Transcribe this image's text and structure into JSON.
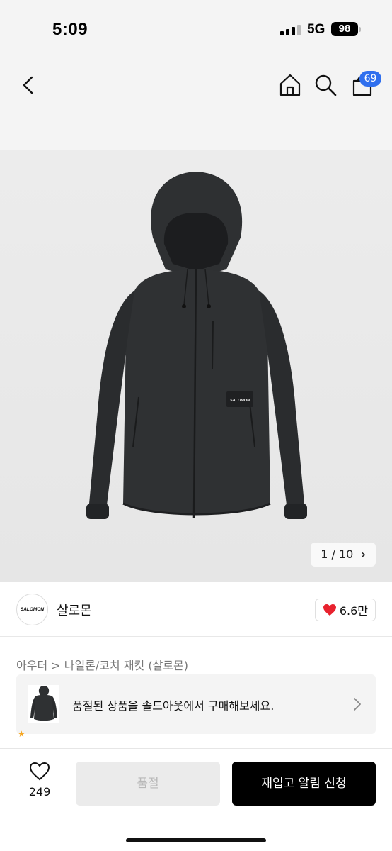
{
  "status_bar": {
    "time": "5:09",
    "network": "5G",
    "battery": "98"
  },
  "nav": {
    "back_icon": "chevron-left-icon",
    "home_icon": "home-icon",
    "search_icon": "search-icon",
    "cart_icon": "shopping-bag-icon",
    "cart_count": "69",
    "badge_color": "#2f6fee"
  },
  "gallery": {
    "page_indicator": "1 / 10",
    "chevron": "›",
    "logo_on_jacket": "SALOMON"
  },
  "brand": {
    "logo_text": "SALOMON",
    "name": "살로몬",
    "like_count": "6.6만",
    "heart_color": "#e8222e"
  },
  "category": {
    "path": "아우터 > 나일론/코치 재킷 (살로몬)"
  },
  "soldout_banner": {
    "text": "품절된 상품을 솔드아웃에서 구매해보세요."
  },
  "bottom_bar": {
    "wish_count": "249",
    "soldout_label": "품절",
    "restock_label": "재입고 알림 신청"
  }
}
